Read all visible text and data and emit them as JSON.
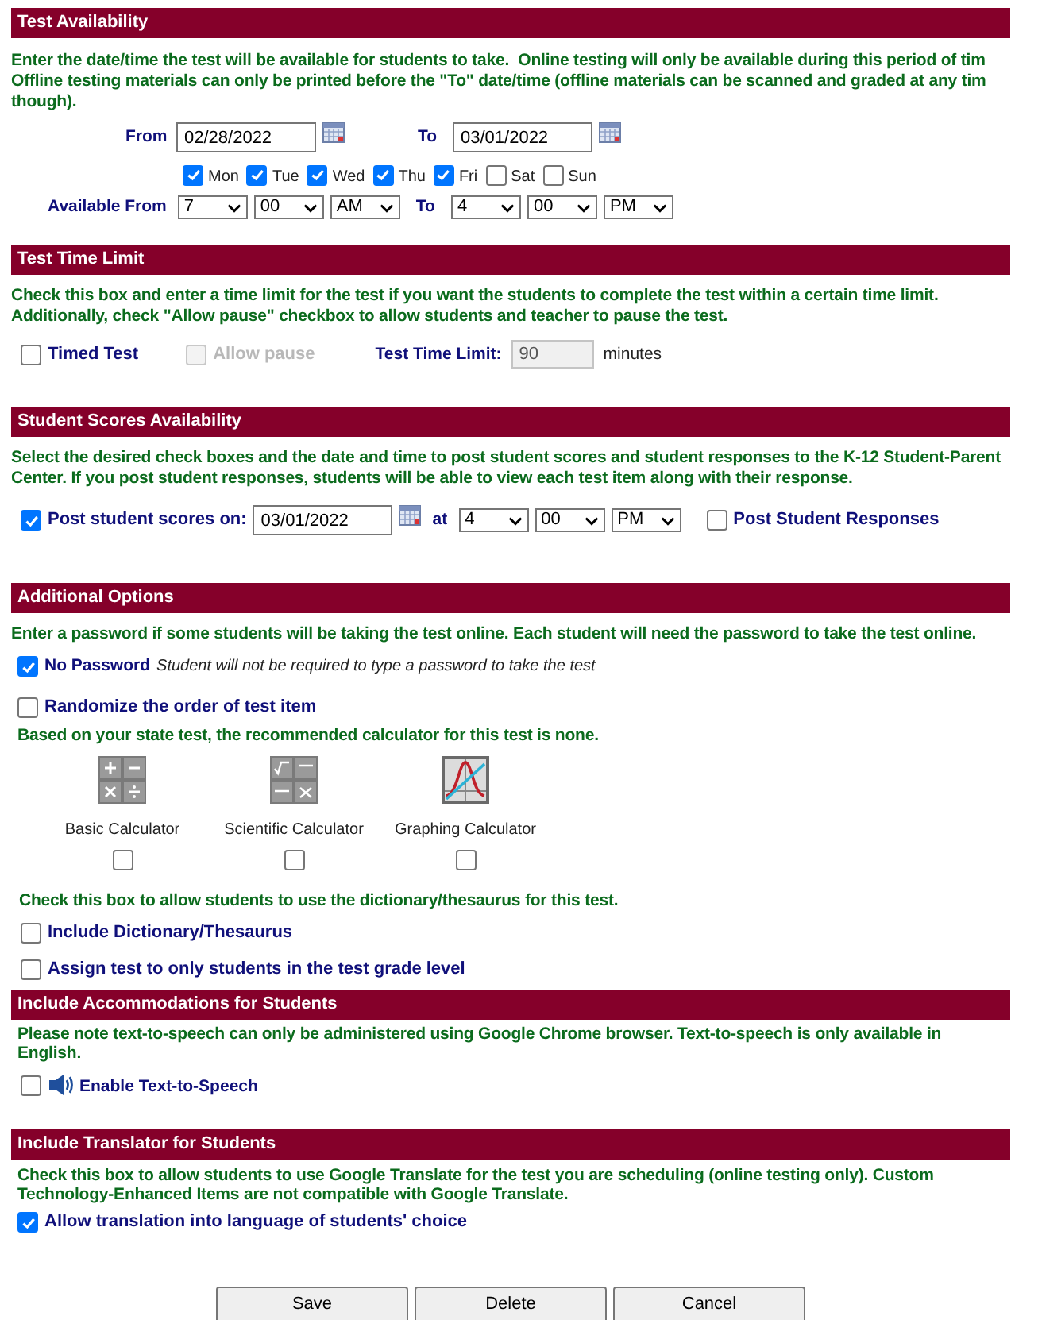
{
  "test_availability": {
    "title": "Test Availability",
    "description_lines": [
      "Enter the date/time the test will be available for students to take.  Online testing will only be available during this period of tim",
      "Offline testing materials can only be printed before the \"To\" date/time (offline materials can be scanned and graded at any tim",
      "though)."
    ],
    "from": {
      "label": "From",
      "value": "02/28/2022"
    },
    "to": {
      "label": "To",
      "value": "03/01/2022"
    },
    "days": [
      {
        "label": "Mon",
        "checked": true
      },
      {
        "label": "Tue",
        "checked": true
      },
      {
        "label": "Wed",
        "checked": true
      },
      {
        "label": "Thu",
        "checked": true
      },
      {
        "label": "Fri",
        "checked": true
      },
      {
        "label": "Sat",
        "checked": false
      },
      {
        "label": "Sun",
        "checked": false
      }
    ],
    "time_label": "Available From",
    "start_time": [
      "7",
      "00",
      "AM"
    ],
    "to_label": "To",
    "end_time": [
      "4",
      "00",
      "PM"
    ]
  },
  "test_time_limit": {
    "title": "Test Time Limit",
    "description": "Check this box and enter a time limit for the test if you want the students to complete the test within a certain time limit. Additionally, check \"Allow pause\" checkbox to allow students and teacher to pause the test.",
    "timed_test": {
      "label": "Timed Test",
      "checked": false
    },
    "allow_pause": {
      "label": "Allow pause",
      "checked": false,
      "disabled": true
    },
    "limit_label": "Test Time Limit:",
    "limit_value": "90",
    "limit_disabled": true,
    "unit": "minutes"
  },
  "student_scores": {
    "title": "Student Scores Availability",
    "description": "Select the desired check boxes and the date and time to post student scores and student responses to the K-12 Student-Parent Center. If you post student responses, students will be able to view each test item along with their response.",
    "post_scores": {
      "label": "Post student scores on:",
      "checked": true
    },
    "date": "03/01/2022",
    "at_label": "at",
    "time": [
      "4",
      "00",
      "PM"
    ],
    "post_responses": {
      "label": "Post Student Responses",
      "checked": false
    }
  },
  "additional_options": {
    "title": "Additional Options",
    "password_note": "Enter a password if some students will be taking the test online.  Each student will need the password to take the test online.",
    "no_password": {
      "label": "No Password",
      "hint": "Student will not be required to type a password to take the test",
      "checked": true
    },
    "randomize": {
      "label": "Randomize the order of test item",
      "checked": false
    },
    "calculator_note": "Based on your state test, the recommended calculator for this test is none.",
    "calculators": [
      {
        "kind": "basic",
        "label": "Basic Calculator",
        "checked": false
      },
      {
        "kind": "scientific",
        "label": "Scientific Calculator",
        "checked": false
      },
      {
        "kind": "graphing",
        "label": "Graphing Calculator",
        "checked": false
      }
    ],
    "dictionary_note": "Check this box to allow students to use the dictionary/thesaurus for this test.",
    "dictionary": {
      "label": "Include Dictionary/Thesaurus",
      "checked": false
    },
    "grade_level": {
      "label": "Assign test to only students in the test grade level",
      "checked": false
    }
  },
  "accommodations": {
    "title": "Include Accommodations for Students",
    "description": "Please note text-to-speech can only be administered using Google Chrome browser. Text-to-speech is only available in English.",
    "text_to_speech": {
      "label": "Enable Text-to-Speech",
      "checked": false
    }
  },
  "translator": {
    "title": "Include Translator for Students",
    "description": "Check this box to allow students to use Google Translate for the test you are scheduling (online testing only). Custom Technology-Enhanced Items are not compatible with Google Translate.",
    "allow_translation": {
      "label": "Allow translation into language of students' choice",
      "checked": true
    }
  },
  "buttons": [
    "Save",
    "Delete",
    "Cancel"
  ]
}
